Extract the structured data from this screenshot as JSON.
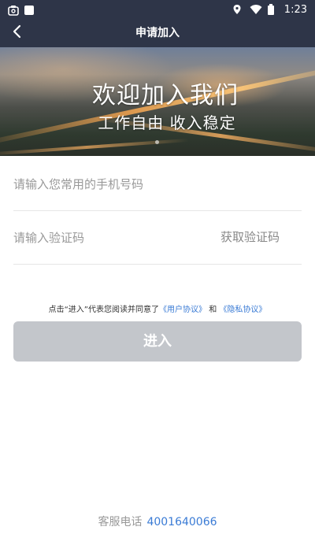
{
  "status_bar": {
    "time": "1:23",
    "icons": [
      "camera-lock-icon",
      "square-icon",
      "location-icon",
      "wifi-icon",
      "battery-icon"
    ]
  },
  "header": {
    "title": "申请加入",
    "back_icon": "chevron-left-icon"
  },
  "banner": {
    "title": "欢迎加入我们",
    "subtitle": "工作自由  收入稳定"
  },
  "form": {
    "phone_placeholder": "请输入您常用的手机号码",
    "code_placeholder": "请输入验证码",
    "get_code_label": "获取验证码"
  },
  "agreement": {
    "prefix": "点击“进入”代表您阅读并同意了",
    "user_agreement": "《用户协议》",
    "and": "和",
    "privacy_agreement": "《隐私协议》"
  },
  "enter_button": {
    "label": "进入"
  },
  "footer": {
    "label": "客服电话",
    "phone": "4001640066"
  },
  "colors": {
    "header_bg": "#2e3548",
    "link": "#3a7bd5",
    "button_disabled": "#c3c6cb"
  }
}
